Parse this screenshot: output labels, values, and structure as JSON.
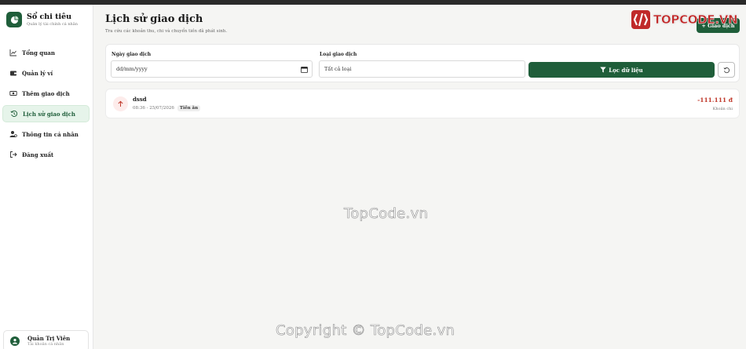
{
  "colors": {
    "accent": "#1f5e3a",
    "active_nav_bg": "#e6f4ea",
    "expense": "#c0392b",
    "expense_icon_bg": "#fdeceb"
  },
  "sidebar": {
    "brand": {
      "title": "Sổ chi tiêu",
      "subtitle": "Quản lý tài chính cá nhân",
      "icon": "pie-chart-icon"
    },
    "items": [
      {
        "label": "Tổng quan",
        "icon": "trend-chart-icon",
        "active": false
      },
      {
        "label": "Quản lý ví",
        "icon": "wallet-icon",
        "active": false
      },
      {
        "label": "Thêm giao dịch",
        "icon": "money-add-icon",
        "active": false
      },
      {
        "label": "Lịch sử giao dịch",
        "icon": "history-icon",
        "active": true
      },
      {
        "label": "Thông tin cá nhân",
        "icon": "user-gear-icon",
        "active": false
      },
      {
        "label": "Đăng xuất",
        "icon": "logout-icon",
        "active": false
      }
    ],
    "user": {
      "name": "Quản Trị Viên",
      "role": "Tài khoản cá nhân",
      "icon": "user-icon"
    }
  },
  "header": {
    "title": "Lịch sử giao dịch",
    "subtitle": "Tra cứu các khoản thu, chi và chuyển tiền đã phát sinh.",
    "add_button": "+ Giao dịch"
  },
  "filters": {
    "date_label": "Ngày giao dịch",
    "date_placeholder": "dd/mm/yyyy",
    "type_label": "Loại giao dịch",
    "type_value": "Tất cả loại",
    "filter_button": "Lọc dữ liệu",
    "reset_icon": "reset-icon"
  },
  "transactions": [
    {
      "name": "dssd",
      "time": "08:36 - 25/07/2026",
      "badge": "Tiền ăn",
      "amount": "-111.111 đ",
      "category": "Khoản chi",
      "direction": "expense",
      "icon": "arrow-up-icon"
    }
  ],
  "watermarks": {
    "logo_text": "TOPCODE.VN",
    "center": "TopCode.vn",
    "bottom": "Copyright © TopCode.vn"
  }
}
